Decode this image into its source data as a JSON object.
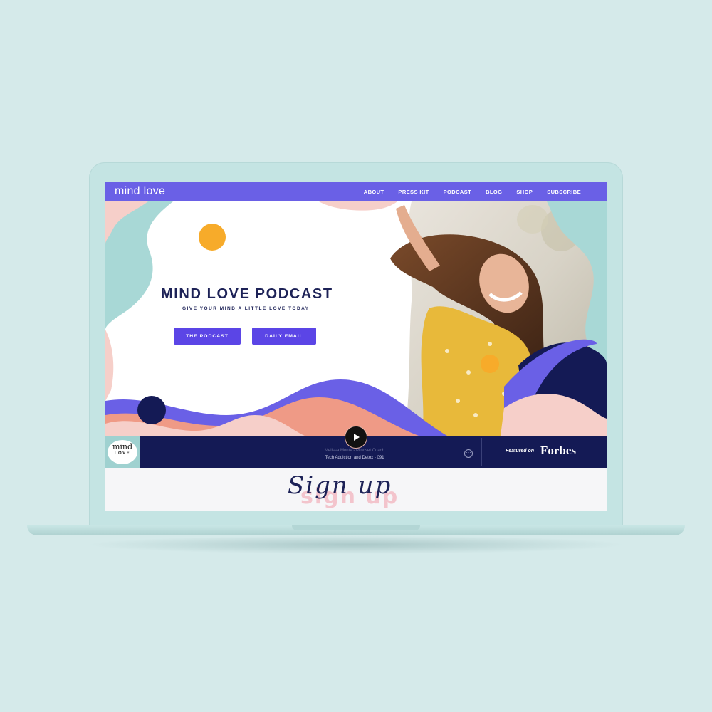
{
  "site": {
    "logo": "mind love"
  },
  "nav": {
    "items": [
      {
        "label": "ABOUT"
      },
      {
        "label": "PRESS KIT"
      },
      {
        "label": "PODCAST"
      },
      {
        "label": "BLOG"
      },
      {
        "label": "SHOP"
      },
      {
        "label": "SUBSCRIBE"
      }
    ]
  },
  "hero": {
    "title": "MIND LOVE PODCAST",
    "subtitle": "GIVE YOUR MIND A LITTLE LOVE TODAY",
    "buttons": {
      "podcast": "THE PODCAST",
      "email": "DAILY EMAIL"
    }
  },
  "player": {
    "thumb_top": "mind",
    "thumb_bottom": "LOVE",
    "artist": "Melissa Monte - Mindset Coach",
    "episode": "Tech Addiction and Detox - 091",
    "more_symbol": "⋯"
  },
  "featured": {
    "label": "Featured on",
    "brand": "Forbes"
  },
  "signup": {
    "script_text": "Sign up",
    "shadow_text": "sign up"
  },
  "colors": {
    "nav": "#6a60e6",
    "navy": "#141a55",
    "button": "#5b45e6",
    "teal": "#a8d8d6",
    "pink": "#f6cfc9",
    "coral": "#ef9a86",
    "yellow": "#f7ab2a",
    "background": "#d5eaea"
  }
}
